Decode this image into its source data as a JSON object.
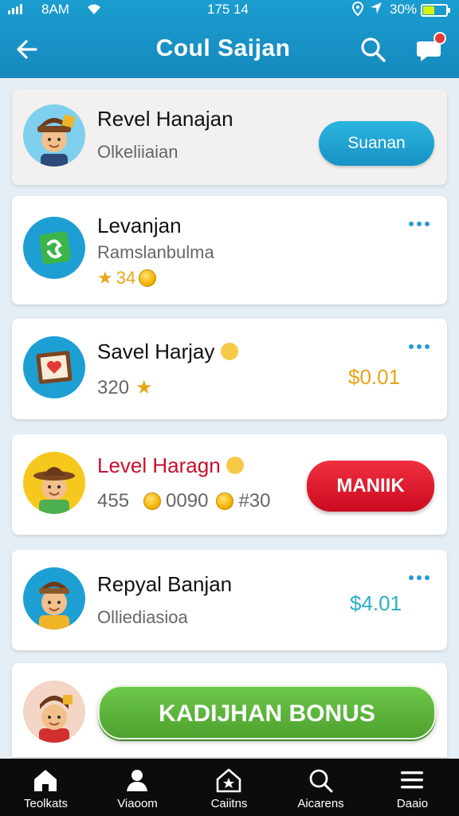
{
  "status_bar": {
    "carrier": "8AM",
    "time": "175 14",
    "battery": "30%"
  },
  "header": {
    "title": "Coul Saijan"
  },
  "cards": [
    {
      "name": "Revel Hanajan",
      "subtitle": "Olkeliiaian",
      "button_label": "Suanan"
    },
    {
      "name": "Levanjan",
      "subtitle": "Ramslanbulma",
      "score": "34"
    },
    {
      "name": "Savel Harjay",
      "score": "320",
      "price": "$0.01"
    },
    {
      "name": "Level Haragn",
      "score": "455",
      "coins": "0090",
      "extra": "#30",
      "button_label": "MANIIK"
    },
    {
      "name": "Repyal Banjan",
      "subtitle": "Olliediasioa",
      "price": "$4.01"
    }
  ],
  "bonus_button": {
    "label": "KADIJHAN BONUS"
  },
  "nav": {
    "items": [
      {
        "label": "Teolkats",
        "icon": "home-icon"
      },
      {
        "label": "Viaoom",
        "icon": "profile-icon"
      },
      {
        "label": "Caiitns",
        "icon": "house-star-icon"
      },
      {
        "label": "Aicarens",
        "icon": "search-icon"
      },
      {
        "label": "Daaio",
        "icon": "menu-icon"
      }
    ]
  },
  "colors": {
    "header": "#1b9dd0",
    "accent_blue": "#1e9fd4",
    "red": "#e8102a",
    "green": "#5cb838",
    "gold": "#e8a51a",
    "teal_price": "#2bb0c9"
  }
}
